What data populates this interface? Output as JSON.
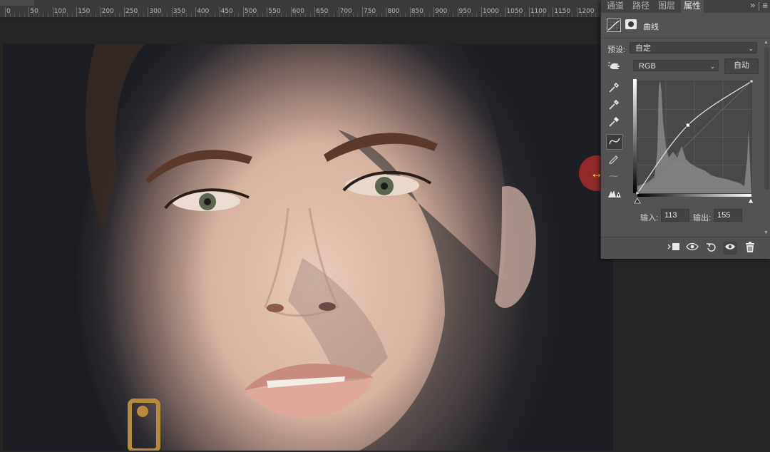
{
  "ruler": {
    "labels": [
      "0",
      "50",
      "100",
      "150",
      "200",
      "250",
      "300",
      "350",
      "400",
      "450",
      "500",
      "550",
      "600",
      "650",
      "700",
      "750",
      "800",
      "850",
      "900",
      "950",
      "1000",
      "1050",
      "1100",
      "1150",
      "1200"
    ]
  },
  "panel": {
    "tabs": [
      "通道",
      "路径",
      "图层",
      "属性"
    ],
    "active_tab": "属性",
    "expand_icon": "»",
    "menu_icon": "≡",
    "title": "曲线",
    "preset_label": "预设:",
    "preset_value": "自定",
    "channel_value": "RGB",
    "auto_label": "自动",
    "input_label": "输入:",
    "input_value": "113",
    "output_label": "输出:",
    "output_value": "155",
    "tools": [
      "hand-adjust-icon",
      "black-point-eyedropper-icon",
      "gray-point-eyedropper-icon",
      "white-point-eyedropper-icon",
      "curve-point-icon",
      "pencil-icon",
      "smooth-icon",
      "clipping-warning-icon"
    ],
    "bottom_icons": [
      "clip-to-layer-icon",
      "view-previous-icon",
      "reset-icon",
      "visibility-icon",
      "trash-icon"
    ]
  },
  "curve": {
    "control_points": [
      [
        0,
        0
      ],
      [
        113,
        155
      ],
      [
        255,
        255
      ]
    ]
  },
  "cursor": {
    "icon": "horizontal-resize-icon",
    "glyph": "↔"
  },
  "colors": {
    "panel_bg": "#535353",
    "canvas_bg": "#262626",
    "cursor_highlight": "#be2d2d",
    "cursor_arrow": "#ffe44a"
  }
}
